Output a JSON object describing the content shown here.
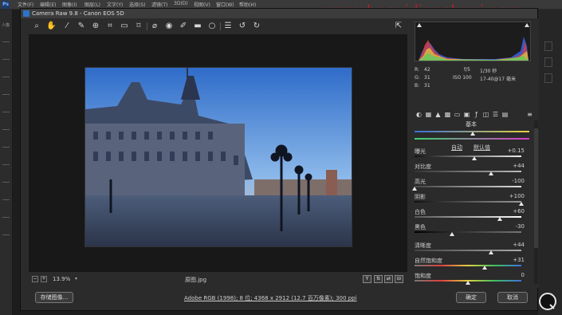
{
  "photoshop": {
    "logo": "Ps",
    "menus": [
      "文件(F)",
      "编辑(E)",
      "图像(I)",
      "图层(L)",
      "文字(Y)",
      "选择(S)",
      "滤镜(T)",
      "3D(D)",
      "视图(V)",
      "窗口(W)",
      "帮助(H)"
    ],
    "tools_label": "人像"
  },
  "watermark": "www.baoyidianshuai.com",
  "dialog": {
    "title": "Camera Raw 9.8  -  Canon EOS 5D"
  },
  "toolbar": {
    "icons": [
      "zoom-icon",
      "hand-icon",
      "white-balance-icon",
      "color-sampler-icon",
      "targeted-adjustment-icon",
      "crop-icon",
      "straighten-icon",
      "transform-icon",
      "spot-removal-icon",
      "red-eye-icon",
      "adjustment-brush-icon",
      "graduated-filter-icon",
      "radial-filter-icon",
      "preferences-icon",
      "rotate-ccw-icon",
      "rotate-cw-icon"
    ],
    "fullscreen_icon": "fullscreen-icon"
  },
  "histogram": {
    "r_label": "R:",
    "r_value": "42",
    "g_label": "G:",
    "g_value": "31",
    "b_label": "B:",
    "b_value": "31",
    "aperture": "f/5",
    "shutter": "1/30 秒",
    "iso": "ISO 100",
    "lens": "17-40@17 毫米"
  },
  "panel": {
    "section_title": "基本",
    "auto": "自动",
    "default": "默认值",
    "sliders": [
      {
        "label": "曝光",
        "value": "+0.15",
        "pos": 0.56
      },
      {
        "label": "对比度",
        "value": "+44",
        "pos": 0.72
      },
      {
        "label": "高光",
        "value": "-100",
        "pos": 0.0
      },
      {
        "label": "阴影",
        "value": "+100",
        "pos": 1.0
      },
      {
        "label": "白色",
        "value": "+60",
        "pos": 0.8
      },
      {
        "label": "黑色",
        "value": "-30",
        "pos": 0.35
      },
      {
        "label": "清晰度",
        "value": "+44",
        "pos": 0.72
      },
      {
        "label": "自然饱和度",
        "value": "+31",
        "pos": 0.655
      },
      {
        "label": "饱和度",
        "value": "0",
        "pos": 0.5
      }
    ]
  },
  "status": {
    "zoom": "13.9%",
    "filename": "原图.jpg"
  },
  "bottom": {
    "save_label": "存储图像...",
    "workflow": "Adobe RGB (1998); 8 位; 4368 x 2912 (12.7 百万像素); 300 ppi",
    "ok_label": "确定",
    "cancel_label": "取消"
  },
  "colors": {
    "watermark": "#ff1a28",
    "panel_bg": "#2b2b2b",
    "canvas_bg": "#181818"
  }
}
